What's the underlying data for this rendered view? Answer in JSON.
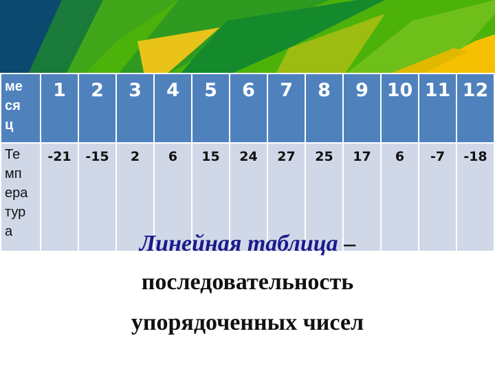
{
  "slide": {
    "table": {
      "header": {
        "label": "ме ся ц",
        "months": [
          "1",
          "2",
          "3",
          "4",
          "5",
          "6",
          "7",
          "8",
          "9",
          "10",
          "11",
          "12"
        ]
      },
      "row": {
        "label": "Те мп ера тур а",
        "temperatures": [
          "-21",
          "-15",
          "2",
          "6",
          "15",
          "24",
          "27",
          "25",
          "17",
          "6",
          "-7",
          "-18"
        ]
      }
    },
    "caption": {
      "term": "Линейная  таблица",
      "dash": " –",
      "line2": "последовательность",
      "line3": "упорядоченных  чисел"
    }
  },
  "colors": {
    "header_bg": "#4f81bd",
    "body_bg": "#d0d8e8",
    "term": "#1a1a8c"
  }
}
